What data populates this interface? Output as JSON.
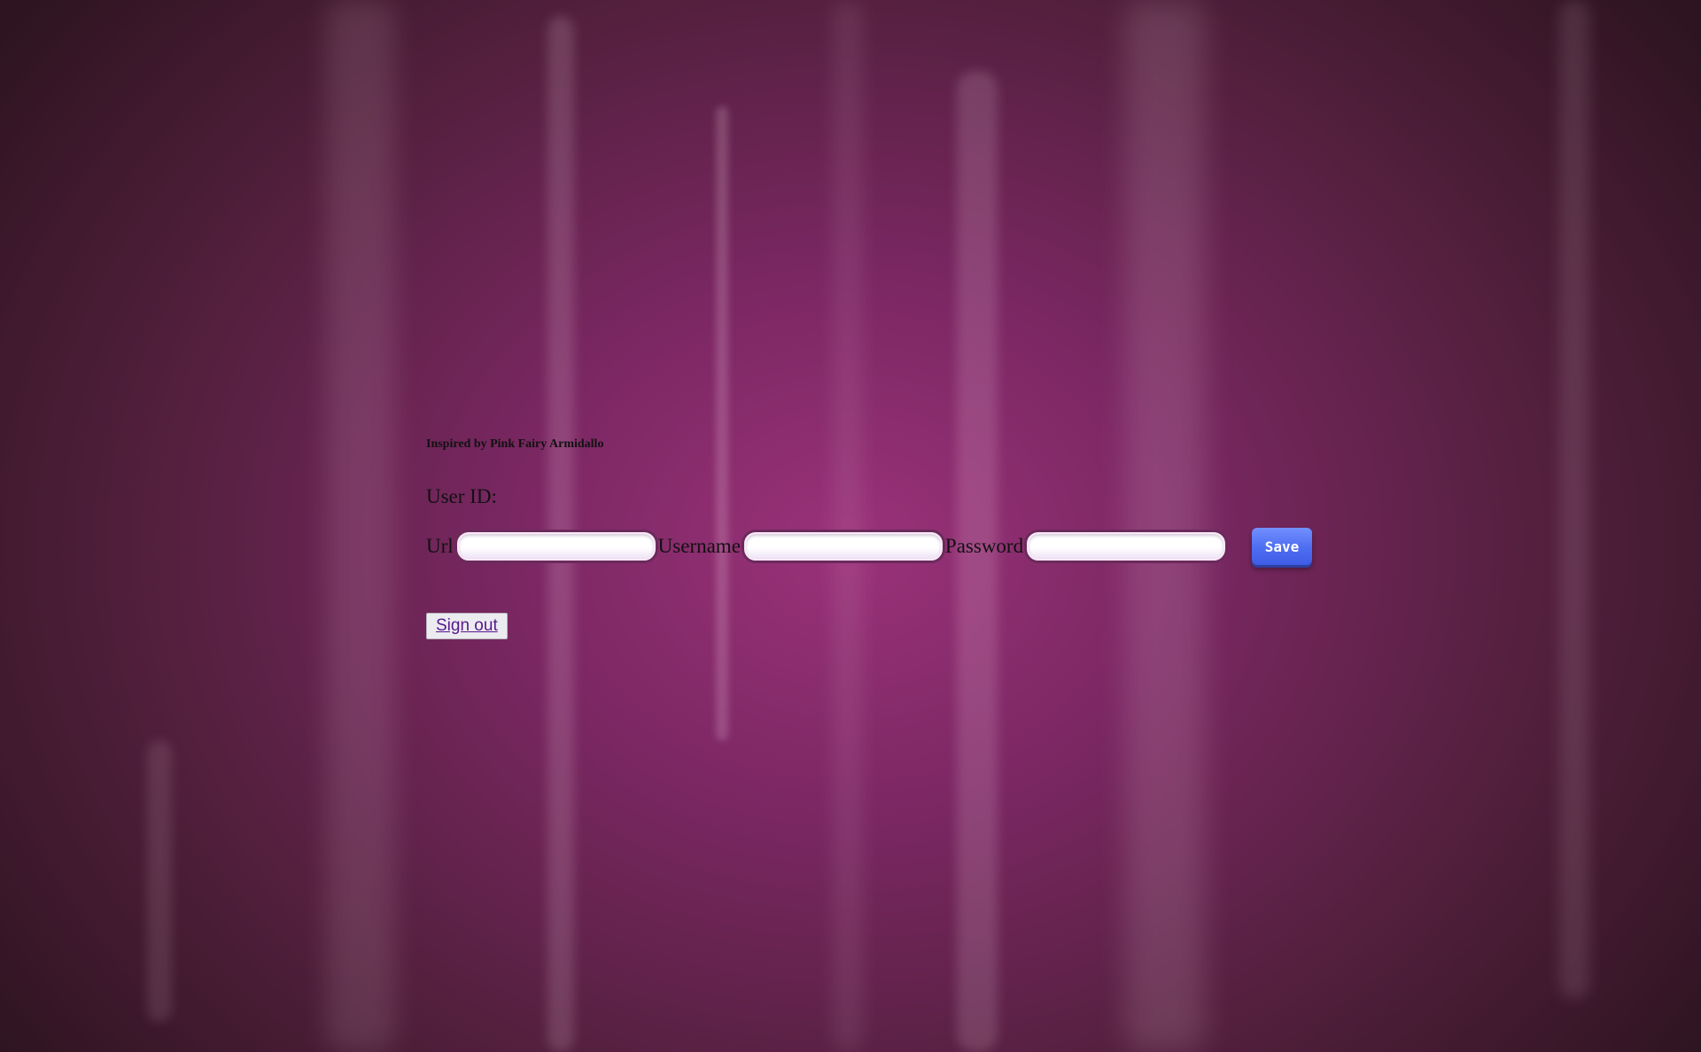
{
  "credit": "Inspired by Pink Fairy Armidallo",
  "user_id_label": "User ID:",
  "form": {
    "url_label": "Url",
    "url_value": "",
    "username_label": "Username",
    "username_value": "",
    "password_label": "Password",
    "password_value": "",
    "save_label": "Save"
  },
  "signout_label": "Sign out",
  "colors": {
    "background_center": "#9a3279",
    "background_edge": "#2e1420",
    "save_button": "#4d6df1",
    "link": "#551a8b"
  }
}
